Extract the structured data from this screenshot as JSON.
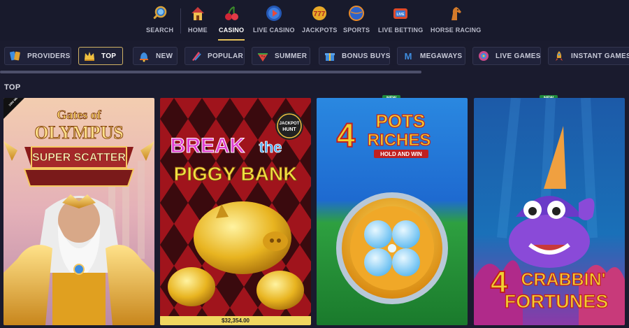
{
  "topnav": {
    "items": [
      {
        "label": "SEARCH",
        "icon": "search-icon"
      },
      {
        "label": "HOME",
        "icon": "home-icon"
      },
      {
        "label": "CASINO",
        "icon": "cherries-icon",
        "active": true
      },
      {
        "label": "LIVE CASINO",
        "icon": "play-icon"
      },
      {
        "label": "JACKPOTS",
        "icon": "jackpot-777-icon"
      },
      {
        "label": "SPORTS",
        "icon": "ball-icon"
      },
      {
        "label": "LIVE BETTING",
        "icon": "live-tv-icon"
      },
      {
        "label": "HORSE RACING",
        "icon": "horse-icon"
      }
    ]
  },
  "categories": {
    "items": [
      {
        "label": "PROVIDERS",
        "icon": "providers-icon"
      },
      {
        "label": "TOP",
        "icon": "crown-icon",
        "active": true
      },
      {
        "label": "NEW",
        "icon": "bell-icon"
      },
      {
        "label": "POPULAR",
        "icon": "popular-icon"
      },
      {
        "label": "SUMMER",
        "icon": "watermelon-icon"
      },
      {
        "label": "BONUS BUYS",
        "icon": "gift-icon"
      },
      {
        "label": "MEGAWAYS",
        "icon": "megaways-icon"
      },
      {
        "label": "LIVE GAMES",
        "icon": "roulette-icon"
      },
      {
        "label": "INSTANT GAMES",
        "icon": "rocket-icon"
      }
    ]
  },
  "section": {
    "title": "TOP"
  },
  "games": [
    {
      "title_line1": "Gates of",
      "title_line2": "OLYMPUS",
      "title_line3": "SUPER SCATTER",
      "corner_badge": "1000 WINS"
    },
    {
      "title_line1": "BREAK",
      "title_word": "the",
      "title_line2": "PIGGY BANK",
      "corner_badge_line1": "JACKPOT",
      "corner_badge_line2": "HUNT",
      "jackpot": "$32,354.00"
    },
    {
      "title_line1": "4",
      "title_word": "POTS",
      "title_line2": "RICHES",
      "subtitle": "HOLD AND WIN",
      "badge": "NEW"
    },
    {
      "title_line1": "4",
      "title_word": "CRABBIN'",
      "title_line2": "FORTUNES",
      "badge": "NEW"
    }
  ],
  "colors": {
    "background": "#1a1b2e",
    "accent": "#e6c25a",
    "new_badge": "#1f8a3c"
  }
}
